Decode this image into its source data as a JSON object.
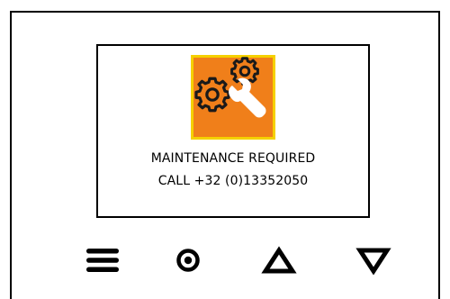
{
  "screen": {
    "icon": "maintenance-gears-wrench-icon",
    "colors": {
      "icon_background": "#f07f1a",
      "icon_border": "#f5d000",
      "icon_glyph": "#ffffff",
      "outline": "#000000"
    },
    "message": {
      "line1": "MAINTENANCE REQUIRED",
      "line2": "CALL +32 (0)13352050"
    }
  },
  "buttons": [
    {
      "icon": "menu-icon"
    },
    {
      "icon": "select-icon"
    },
    {
      "icon": "up-triangle-icon"
    },
    {
      "icon": "down-triangle-icon"
    }
  ]
}
